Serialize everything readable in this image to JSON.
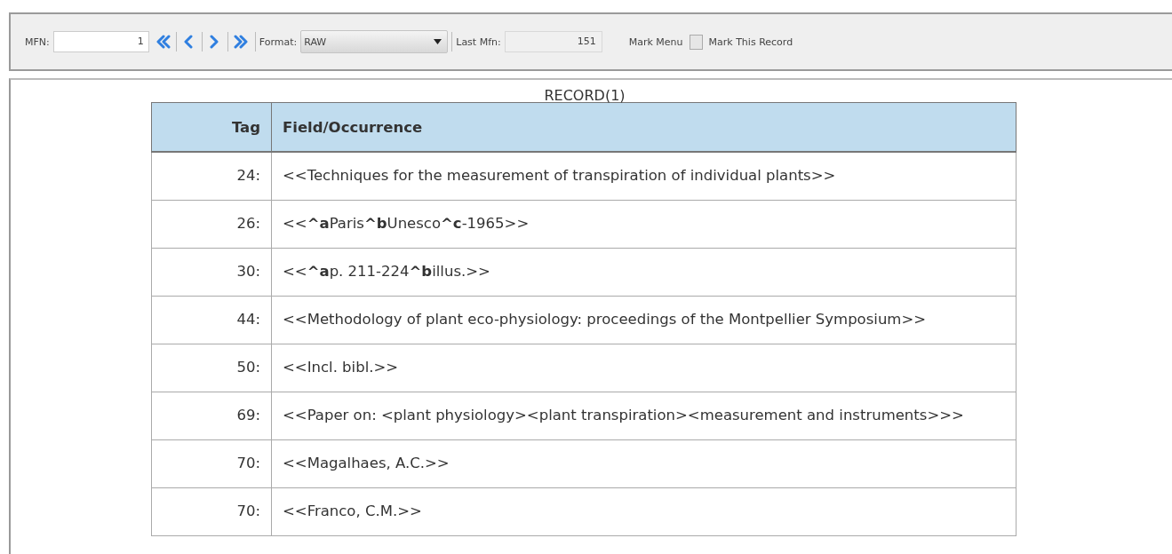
{
  "toolbar": {
    "mfn_label": "MFN:",
    "mfn_value": "1",
    "nav_buttons": [
      {
        "kind": "first"
      },
      {
        "kind": "prev"
      },
      {
        "kind": "next"
      },
      {
        "kind": "last"
      }
    ],
    "format_label": "Format:",
    "format_value": "RAW",
    "last_mfn_label": "Last Mfn:",
    "last_mfn_value": "151",
    "mark_menu": "Mark Menu",
    "mark_record": {
      "label": "Mark This Record",
      "checked": false
    }
  },
  "record": {
    "title": "RECORD(1)",
    "columns": [
      "Tag",
      "Field/Occurrence"
    ],
    "rows": [
      {
        "tag": "24:",
        "value": "<<Techniques for the measurement of transpiration of individual plants>>"
      },
      {
        "tag": "26:",
        "value": "<<**^a**Paris**^b**Unesco**^c**-1965>>"
      },
      {
        "tag": "30:",
        "value": "<<**^a**p. 211-224**^b**illus.>>"
      },
      {
        "tag": "44:",
        "value": "<<Methodology of plant eco-physiology: proceedings of the Montpellier Symposium>>"
      },
      {
        "tag": "50:",
        "value": "<<Incl. bibl.>>"
      },
      {
        "tag": "69:",
        "value": "<<Paper on: <plant physiology><plant transpiration><measurement and instruments>>>"
      },
      {
        "tag": "70:",
        "value": "<<Magalhaes, A.C.>>"
      },
      {
        "tag": "70:",
        "value": "<<Franco, C.M.>>"
      }
    ]
  }
}
